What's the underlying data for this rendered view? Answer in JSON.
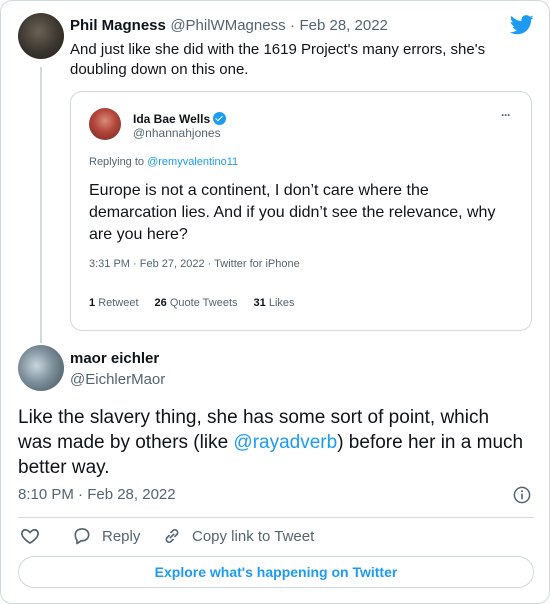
{
  "parent_tweet": {
    "author_name": "Phil Magness",
    "author_handle": "@PhilWMagness",
    "separator": "·",
    "date": "Feb 28, 2022",
    "text": "And just like she did with the 1619 Project's many errors, she's doubling down on this one."
  },
  "quoted_tweet": {
    "author_name": "Ida Bae Wells",
    "author_handle": "@nhannahjones",
    "more": "···",
    "replying_prefix": "Replying to ",
    "replying_to": "@remyvalentino11",
    "text": "Europe is not a continent, I don’t care where the demarcation lies. And if you didn’t see the relevance, why are you here?",
    "timestamp": "3:31 PM · Feb 27, 2022 · Twitter for iPhone",
    "stats": [
      {
        "count": "1",
        "label": "Retweet"
      },
      {
        "count": "26",
        "label": "Quote Tweets"
      },
      {
        "count": "31",
        "label": "Likes"
      }
    ]
  },
  "main_tweet": {
    "author_name": "maor eichler",
    "author_handle": "@EichlerMaor",
    "text_before": "Like the slavery thing, she has some sort of point, which was made by others (like ",
    "mention": "@rayadverb",
    "text_after": ") before her in a much better way.",
    "timestamp": "8:10 PM · Feb 28, 2022"
  },
  "actions": {
    "reply": "Reply",
    "copy_link": "Copy link to Tweet",
    "explore": "Explore what's happening on Twitter"
  },
  "colors": {
    "accent": "#1d9bf0",
    "text": "#0f1419",
    "muted": "#536471",
    "border": "#cfd9de"
  }
}
